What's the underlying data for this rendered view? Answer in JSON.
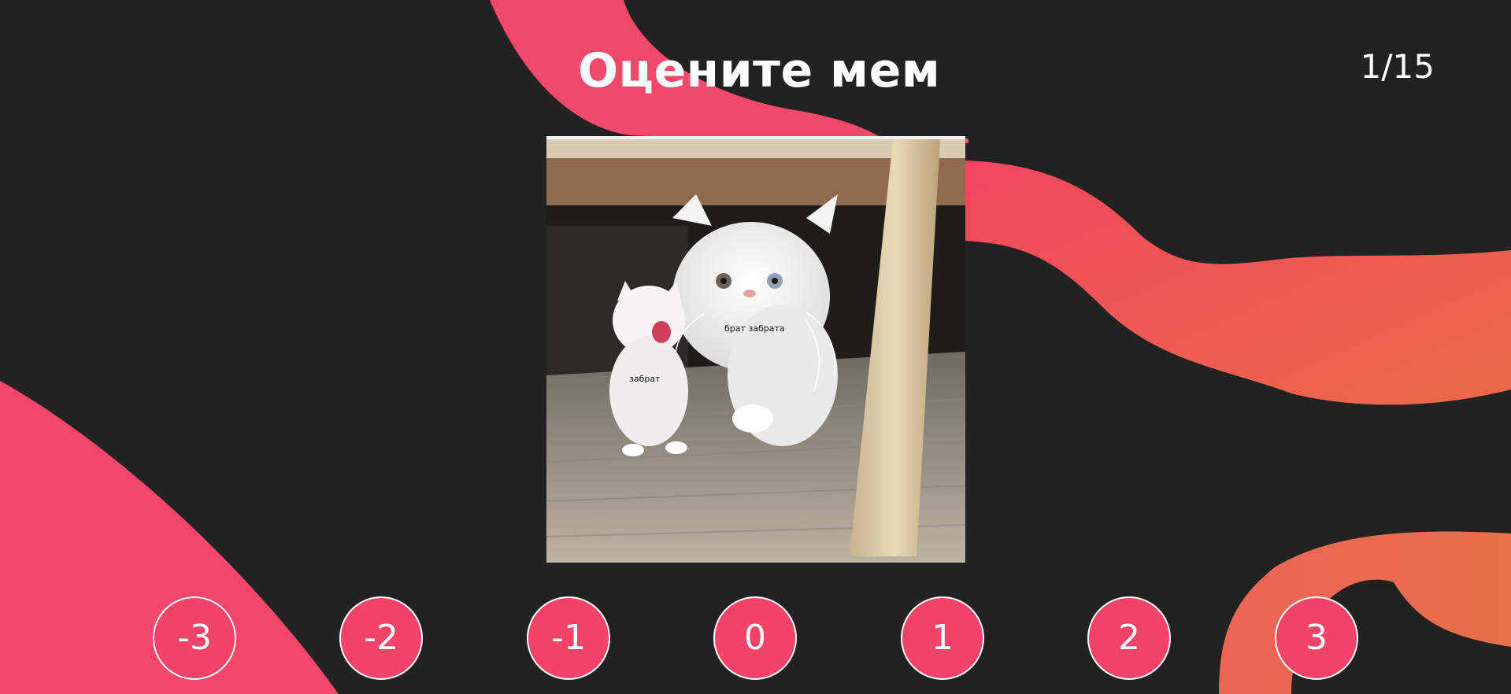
{
  "header": {
    "title": "Оцените мем",
    "counter": "1/15"
  },
  "meme": {
    "captions": {
      "big_cat": "брат забрата",
      "kitten": "забрат"
    }
  },
  "rating": {
    "options": [
      "-3",
      "-2",
      "-1",
      "0",
      "1",
      "2",
      "3"
    ]
  },
  "colors": {
    "background": "#222222",
    "accent_pink": "#f34369",
    "accent_coral": "#ec6a4f",
    "text": "#ffffff"
  }
}
